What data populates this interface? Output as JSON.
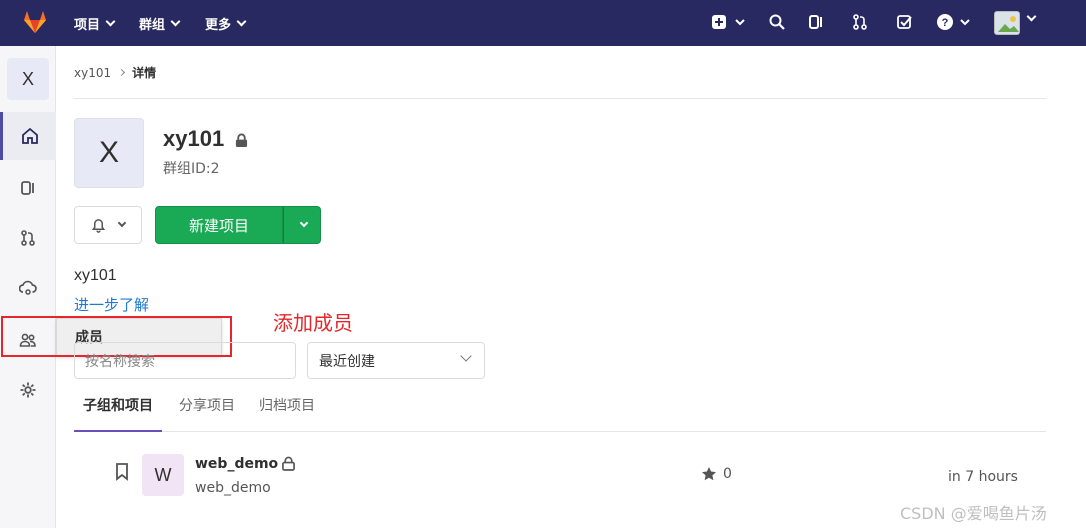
{
  "topbar": {
    "menus": [
      {
        "label": "项目"
      },
      {
        "label": "群组"
      },
      {
        "label": "更多"
      }
    ]
  },
  "sidebar": {
    "avatar_letter": "X",
    "flyout_label": "成员"
  },
  "annotation": "添加成员",
  "breadcrumb": {
    "parent": "xy101",
    "current": "详情"
  },
  "group": {
    "avatar_letter": "X",
    "name": "xy101",
    "id_text": "群组ID:2",
    "description": "xy101",
    "learn_more": "进一步了解"
  },
  "actions": {
    "new_project": "新建项目"
  },
  "filters": {
    "search_placeholder": "按名称搜索",
    "sort_value": "最近创建"
  },
  "tabs": [
    {
      "label": "子组和项目"
    },
    {
      "label": "分享项目"
    },
    {
      "label": "归档项目"
    }
  ],
  "projects": [
    {
      "avatar_letter": "W",
      "name": "web_demo",
      "path": "web_demo",
      "stars": "0",
      "updated": "in 7 hours"
    }
  ],
  "watermark": "CSDN @爱喝鱼片汤",
  "colors": {
    "navbar": "#292961",
    "primary_green": "#1aaa55",
    "annotation_red": "#e5262a",
    "link_blue": "#1f78d1"
  }
}
